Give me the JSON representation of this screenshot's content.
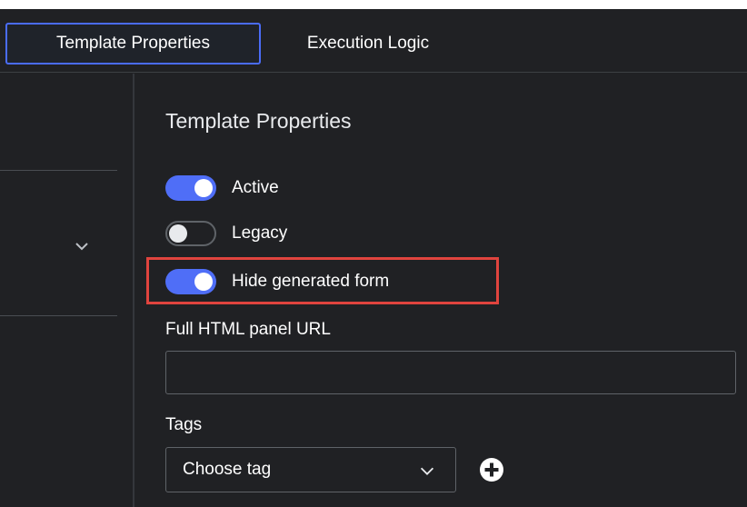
{
  "tabs": [
    {
      "label": "Template Properties",
      "active": true
    },
    {
      "label": "Execution Logic",
      "active": false
    }
  ],
  "section": {
    "title": "Template Properties"
  },
  "toggles": [
    {
      "label": "Active",
      "on": true
    },
    {
      "label": "Legacy",
      "on": false
    },
    {
      "label": "Hide generated form",
      "on": true
    }
  ],
  "url_field": {
    "label": "Full HTML panel URL",
    "value": "",
    "placeholder": ""
  },
  "tags": {
    "label": "Tags",
    "selected": "Choose tag"
  },
  "icons": {
    "left_chevron": "chevron-down-icon",
    "tag_chevron": "chevron-down-icon",
    "add": "plus-circle-icon"
  },
  "colors": {
    "background": "#202124",
    "accent": "#4f6ef7",
    "tab_border": "#4a6cf7",
    "highlight": "#e0443e"
  }
}
